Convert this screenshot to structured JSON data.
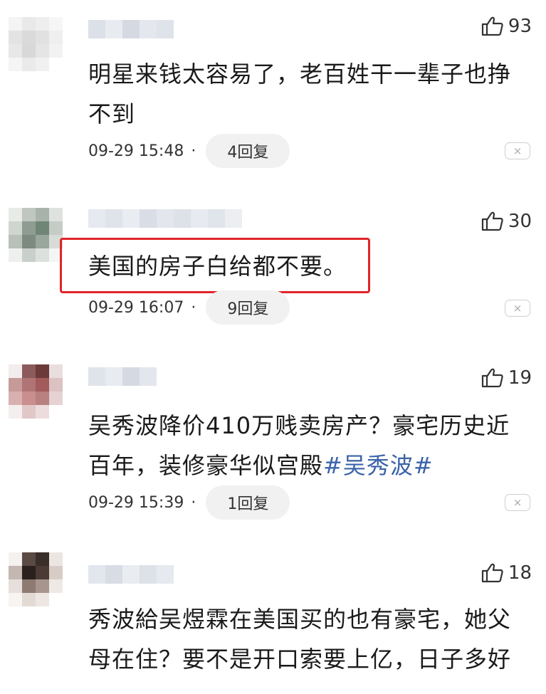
{
  "comments": [
    {
      "likes": "93",
      "text": "明星来钱太容易了，老百姓干一辈子也挣不到",
      "time": "09-29 15:48",
      "dot": "·",
      "replies": "4回复",
      "close": "×",
      "avatar_colors": [
        "#f4f4f4",
        "#e9e9e9",
        "#eeeeee",
        "#f6f6f6",
        "#e3e3e3",
        "#dadada",
        "#e1e1e1",
        "#efefef",
        "#e8e8e8",
        "#d8d8d8",
        "#e5e5e5",
        "#f2f2f2",
        "#f5f5f5",
        "#eaeaea",
        "#f0f0f0",
        "#ffffff"
      ],
      "name_colors": [
        "#dce0e8",
        "#e8ebf0",
        "#d5d9e2",
        "#e4e7ed",
        "#dfe3ea"
      ]
    },
    {
      "likes": "30",
      "text": "美国的房子白给都不要。",
      "time": "09-29 16:07",
      "dot": "·",
      "replies": "9回复",
      "close": "×",
      "avatar_colors": [
        "#e8ebe8",
        "#bfc7c0",
        "#a9b3ab",
        "#dfe3df",
        "#cfd5cf",
        "#8f9c92",
        "#6f8576",
        "#c5ccc6",
        "#b8c0b9",
        "#7d8a80",
        "#9aa79d",
        "#d7dcd7",
        "#eef0ee",
        "#c9cfca",
        "#dde1dd",
        "#f4f5f4"
      ],
      "name_colors": [
        "#e6e9f0",
        "#dfe3ea",
        "#e9ecf1",
        "#d9dde6",
        "#e3e6ed",
        "#dde1e8",
        "#e7eaf0",
        "#e0e4eb",
        "#eceef2"
      ]
    },
    {
      "likes": "19",
      "text_main": "吴秀波降价410万贱卖房产？豪宅历史近百年，装修豪华似宫殿",
      "tag": "#吴秀波#",
      "time": "09-29 15:39",
      "dot": "·",
      "replies": "1回复",
      "close": "×",
      "avatar_colors": [
        "#f3ecec",
        "#8c5a5a",
        "#6d3a3a",
        "#e9dede",
        "#c79a9a",
        "#b07474",
        "#a25a5a",
        "#dcc2c2",
        "#d8b0b0",
        "#c98e8e",
        "#b98080",
        "#e6d2d2",
        "#f5eeee",
        "#e2c7c7",
        "#eddcdc",
        "#ffffff"
      ],
      "name_colors": [
        "#dfe3ea",
        "#e8ebf0",
        "#d5d9e2",
        "#e3e6ed"
      ]
    },
    {
      "likes": "18",
      "text": "秀波給吴煜霖在美国买的也有豪宅，她父母在住？要不是开口索要上亿，日子多好",
      "avatar_colors": [
        "#f4f1ef",
        "#5a4a44",
        "#3a2e2a",
        "#ece6e3",
        "#c4b6b0",
        "#2a201d",
        "#4b3a35",
        "#d8ccc7",
        "#e7dfdb",
        "#8e7a73",
        "#a8958e",
        "#efe9e6",
        "#f7f4f2",
        "#e3dad6",
        "#ede6e3",
        "#ffffff"
      ],
      "name_colors": [
        "#e2e6ed",
        "#d8dce5",
        "#e9ecf1",
        "#dde1e8",
        "#e6e9ef"
      ]
    }
  ],
  "icons": {
    "like": "thumbs-up-icon",
    "close": "close-icon"
  },
  "colors": {
    "highlight_border": "#e0242a",
    "tag_link": "#3a63a8",
    "reply_pill_bg": "#f1f1f1"
  }
}
